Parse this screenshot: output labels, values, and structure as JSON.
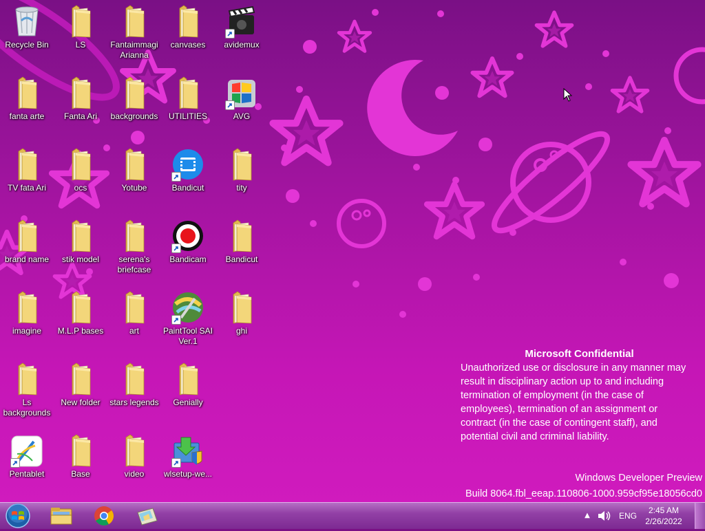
{
  "desktop_icons": [
    {
      "label": "Recycle Bin",
      "icon": "recycle-bin-icon",
      "shortcut": false
    },
    {
      "label": "LS",
      "icon": "folder-icon",
      "shortcut": false
    },
    {
      "label": "Fantaimmagi Arianna",
      "icon": "folder-icon",
      "shortcut": false
    },
    {
      "label": "canvases",
      "icon": "folder-icon",
      "shortcut": false
    },
    {
      "label": "avidemux",
      "icon": "avidemux-icon",
      "shortcut": true
    },
    {
      "label": "fanta arte",
      "icon": "folder-icon",
      "shortcut": false
    },
    {
      "label": "Fanta Ari",
      "icon": "folder-icon",
      "shortcut": false
    },
    {
      "label": "backgrounds",
      "icon": "folder-icon",
      "shortcut": false
    },
    {
      "label": "UTILITIES",
      "icon": "folder-icon",
      "shortcut": false
    },
    {
      "label": "AVG",
      "icon": "avg-icon",
      "shortcut": true
    },
    {
      "label": "TV fata Ari",
      "icon": "folder-icon",
      "shortcut": false
    },
    {
      "label": "ocs",
      "icon": "folder-icon",
      "shortcut": false
    },
    {
      "label": "Yotube",
      "icon": "folder-icon",
      "shortcut": false
    },
    {
      "label": "Bandicut",
      "icon": "bandicut-icon",
      "shortcut": true
    },
    {
      "label": "tity",
      "icon": "folder-icon",
      "shortcut": false
    },
    {
      "label": "brand name",
      "icon": "folder-icon",
      "shortcut": false
    },
    {
      "label": "stik model",
      "icon": "folder-icon",
      "shortcut": false
    },
    {
      "label": "serena's briefcase",
      "icon": "folder-icon",
      "shortcut": false
    },
    {
      "label": "Bandicam",
      "icon": "bandicam-icon",
      "shortcut": true
    },
    {
      "label": "Bandicut",
      "icon": "folder-icon",
      "shortcut": false
    },
    {
      "label": "imagine",
      "icon": "folder-icon",
      "shortcut": false
    },
    {
      "label": "M.L.P bases",
      "icon": "folder-icon",
      "shortcut": false
    },
    {
      "label": "art",
      "icon": "folder-icon",
      "shortcut": false
    },
    {
      "label": "PaintTool SAI Ver.1",
      "icon": "painttool-sai-icon",
      "shortcut": true
    },
    {
      "label": "ghi",
      "icon": "folder-icon",
      "shortcut": false
    },
    {
      "label": "Ls backgrounds",
      "icon": "folder-icon",
      "shortcut": false
    },
    {
      "label": "New folder",
      "icon": "folder-icon",
      "shortcut": false
    },
    {
      "label": "stars legends",
      "icon": "folder-icon",
      "shortcut": false
    },
    {
      "label": "Genially",
      "icon": "folder-icon",
      "shortcut": false
    },
    {
      "label": "Pentablet",
      "icon": "pentablet-icon",
      "shortcut": true
    },
    {
      "label": "Base",
      "icon": "folder-icon",
      "shortcut": false
    },
    {
      "label": "video",
      "icon": "folder-icon",
      "shortcut": false
    },
    {
      "label": "wlsetup-we...",
      "icon": "wlsetup-icon",
      "shortcut": true
    }
  ],
  "watermark": {
    "title": "Microsoft Confidential",
    "lines": [
      "Unauthorized use or disclosure in any manner may",
      "result in disciplinary action up to and including",
      "termination of employment (in the case of",
      "employees), termination of an assignment or",
      "contract (in the case of contingent staff), and",
      "potential civil and criminal liability."
    ]
  },
  "build": {
    "edition": "Windows Developer Preview",
    "version": "Build 8064.fbl_eeap.110806-1000.959cf95e18056cd0"
  },
  "taskbar": {
    "pinned": [
      {
        "name": "file-explorer-icon"
      },
      {
        "name": "chrome-icon"
      },
      {
        "name": "app-icon"
      }
    ],
    "tray": {
      "language": "ENG",
      "time": "2:45 AM",
      "date": "2/26/2022"
    }
  },
  "colors": {
    "wallpaper_top": "#7a1085",
    "wallpaper_bottom": "#d21cbf",
    "pattern": "#e335d6",
    "folder": "#f3d67a"
  }
}
